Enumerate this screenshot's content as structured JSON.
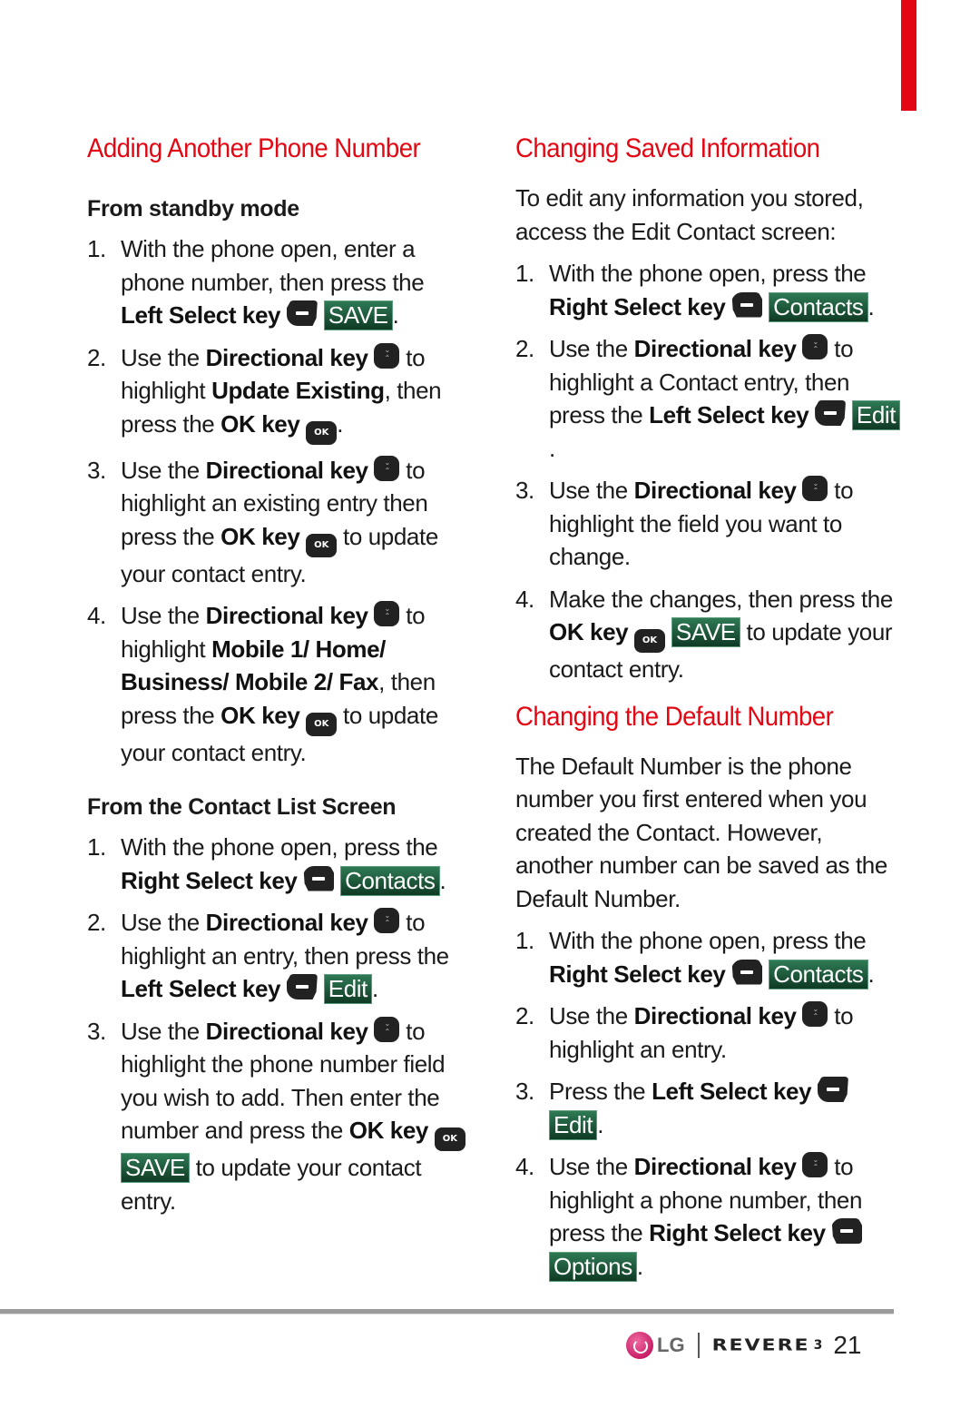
{
  "colors": {
    "accent_red": "#e30613",
    "softkey_green": "#1e5a3c",
    "key_black": "#222222",
    "rule_gray": "#9a9a9a"
  },
  "left": {
    "title": "Adding Another Phone Number",
    "sections": [
      {
        "heading": "From standby mode",
        "steps": [
          {
            "num": "1.",
            "parts": [
              {
                "t": "text",
                "v": "With the phone open, enter a phone number, then press the "
              },
              {
                "t": "bold",
                "v": "Left Select key"
              },
              {
                "t": "icon",
                "v": "left-select-key"
              },
              {
                "t": "softkey",
                "v": "SAVE"
              },
              {
                "t": "text",
                "v": "."
              }
            ]
          },
          {
            "num": "2.",
            "parts": [
              {
                "t": "text",
                "v": "Use the "
              },
              {
                "t": "bold",
                "v": "Directional key"
              },
              {
                "t": "icon",
                "v": "directional-key"
              },
              {
                "t": "text",
                "v": " to highlight "
              },
              {
                "t": "bold",
                "v": "Update Existing"
              },
              {
                "t": "text",
                "v": ", then press the "
              },
              {
                "t": "bold",
                "v": "OK key"
              },
              {
                "t": "icon",
                "v": "ok-key"
              },
              {
                "t": "text",
                "v": "."
              }
            ]
          },
          {
            "num": "3.",
            "parts": [
              {
                "t": "text",
                "v": "Use the "
              },
              {
                "t": "bold",
                "v": "Directional key"
              },
              {
                "t": "icon",
                "v": "directional-key"
              },
              {
                "t": "text",
                "v": " to highlight an existing entry then press the "
              },
              {
                "t": "bold",
                "v": "OK key"
              },
              {
                "t": "icon",
                "v": "ok-key"
              },
              {
                "t": "text",
                "v": " to update your contact entry."
              }
            ]
          },
          {
            "num": "4.",
            "parts": [
              {
                "t": "text",
                "v": "Use the "
              },
              {
                "t": "bold",
                "v": "Directional key"
              },
              {
                "t": "icon",
                "v": "directional-key"
              },
              {
                "t": "text",
                "v": " to highlight "
              },
              {
                "t": "bold",
                "v": "Mobile 1/ Home/ Business/ Mobile 2/ Fax"
              },
              {
                "t": "text",
                "v": ", then press the "
              },
              {
                "t": "bold",
                "v": "OK key"
              },
              {
                "t": "icon",
                "v": "ok-key"
              },
              {
                "t": "text",
                "v": " to update your contact entry."
              }
            ]
          }
        ]
      },
      {
        "heading": "From the Contact List Screen",
        "steps": [
          {
            "num": "1.",
            "parts": [
              {
                "t": "text",
                "v": "With the phone open, press the "
              },
              {
                "t": "bold",
                "v": "Right Select key"
              },
              {
                "t": "icon",
                "v": "right-select-key"
              },
              {
                "t": "softkey",
                "v": "Contacts"
              },
              {
                "t": "text",
                "v": "."
              }
            ]
          },
          {
            "num": "2.",
            "parts": [
              {
                "t": "text",
                "v": "Use the "
              },
              {
                "t": "bold",
                "v": "Directional key"
              },
              {
                "t": "icon",
                "v": "directional-key"
              },
              {
                "t": "text",
                "v": " to highlight an entry, then press the "
              },
              {
                "t": "bold",
                "v": "Left Select key"
              },
              {
                "t": "icon",
                "v": "left-select-key"
              },
              {
                "t": "softkey",
                "v": "Edit"
              },
              {
                "t": "text",
                "v": "."
              }
            ]
          },
          {
            "num": "3.",
            "parts": [
              {
                "t": "text",
                "v": "Use the "
              },
              {
                "t": "bold",
                "v": "Directional key"
              },
              {
                "t": "icon",
                "v": "directional-key"
              },
              {
                "t": "text",
                "v": " to highlight the phone number field you wish to add. Then enter the number and press the "
              },
              {
                "t": "bold",
                "v": "OK key"
              },
              {
                "t": "icon",
                "v": "ok-key"
              },
              {
                "t": "softkey",
                "v": "SAVE"
              },
              {
                "t": "text",
                "v": " to update your contact entry."
              }
            ]
          }
        ]
      }
    ]
  },
  "right": {
    "blocks": [
      {
        "title": "Changing Saved Information",
        "intro": "To edit any information you stored, access the Edit Contact screen:",
        "steps": [
          {
            "num": "1.",
            "parts": [
              {
                "t": "text",
                "v": "With the phone open, press the "
              },
              {
                "t": "bold",
                "v": "Right Select key"
              },
              {
                "t": "icon",
                "v": "right-select-key"
              },
              {
                "t": "softkey",
                "v": "Contacts"
              },
              {
                "t": "text",
                "v": "."
              }
            ]
          },
          {
            "num": "2.",
            "parts": [
              {
                "t": "text",
                "v": "Use the "
              },
              {
                "t": "bold",
                "v": "Directional key"
              },
              {
                "t": "icon",
                "v": "directional-key"
              },
              {
                "t": "text",
                "v": " to highlight a Contact entry, then press the "
              },
              {
                "t": "bold",
                "v": "Left Select key"
              },
              {
                "t": "icon",
                "v": "left-select-key"
              },
              {
                "t": "text",
                "v": " "
              },
              {
                "t": "softkey",
                "v": "Edit"
              },
              {
                "t": "text",
                "v": "."
              }
            ]
          },
          {
            "num": "3.",
            "parts": [
              {
                "t": "text",
                "v": "Use the "
              },
              {
                "t": "bold",
                "v": "Directional key"
              },
              {
                "t": "icon",
                "v": "directional-key"
              },
              {
                "t": "text",
                "v": " to highlight the field you want to change."
              }
            ]
          },
          {
            "num": "4.",
            "parts": [
              {
                "t": "text",
                "v": "Make the changes, then press the "
              },
              {
                "t": "bold",
                "v": "OK key"
              },
              {
                "t": "icon",
                "v": "ok-key"
              },
              {
                "t": "softkey",
                "v": "SAVE"
              },
              {
                "t": "text",
                "v": " to update your contact entry."
              }
            ]
          }
        ]
      },
      {
        "title": "Changing the Default Number",
        "intro": "The Default Number is the phone number you first entered when you created the Contact. However, another number can be saved as the Default Number.",
        "steps": [
          {
            "num": "1.",
            "parts": [
              {
                "t": "text",
                "v": "With the phone open, press the "
              },
              {
                "t": "bold",
                "v": "Right Select key"
              },
              {
                "t": "icon",
                "v": "right-select-key"
              },
              {
                "t": "softkey",
                "v": "Contacts"
              },
              {
                "t": "text",
                "v": "."
              }
            ]
          },
          {
            "num": "2.",
            "parts": [
              {
                "t": "text",
                "v": "Use the "
              },
              {
                "t": "bold",
                "v": "Directional key"
              },
              {
                "t": "icon",
                "v": "directional-key"
              },
              {
                "t": "text",
                "v": " to highlight an entry."
              }
            ]
          },
          {
            "num": "3.",
            "parts": [
              {
                "t": "text",
                "v": "Press the "
              },
              {
                "t": "bold",
                "v": "Left Select key"
              },
              {
                "t": "icon",
                "v": "left-select-key"
              },
              {
                "t": "text",
                "v": " "
              },
              {
                "t": "softkey",
                "v": "Edit"
              },
              {
                "t": "text",
                "v": "."
              }
            ]
          },
          {
            "num": "4.",
            "parts": [
              {
                "t": "text",
                "v": "Use the "
              },
              {
                "t": "bold",
                "v": "Directional key"
              },
              {
                "t": "icon",
                "v": "directional-key"
              },
              {
                "t": "text",
                "v": " to highlight a phone number, then press the "
              },
              {
                "t": "bold",
                "v": "Right Select key"
              },
              {
                "t": "icon",
                "v": "right-select-key"
              },
              {
                "t": "text",
                "v": " "
              },
              {
                "t": "softkey",
                "v": "Options"
              },
              {
                "t": "text",
                "v": "."
              }
            ]
          }
        ]
      }
    ]
  },
  "footer": {
    "logo_text": "LG",
    "brand": "REVERE",
    "brand_suffix": "3",
    "page_number": "21"
  },
  "icons": {
    "left-select-key": {
      "class": "icon-lsk",
      "label": ""
    },
    "right-select-key": {
      "class": "icon-rsk",
      "label": ""
    },
    "directional-key": {
      "class": "icon-dir",
      "label": ""
    },
    "ok-key": {
      "class": "icon-ok",
      "label": "OK"
    }
  }
}
